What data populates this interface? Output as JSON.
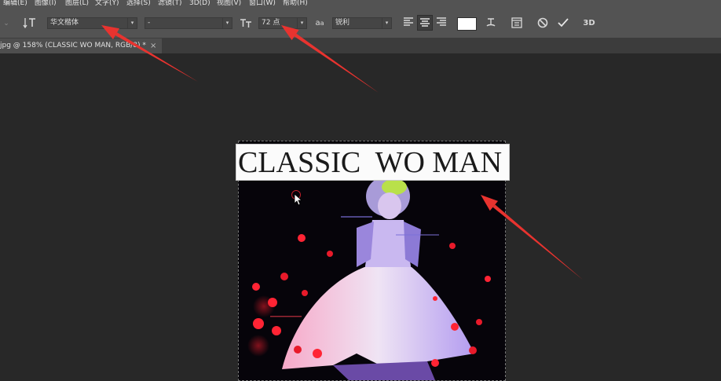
{
  "menu": [
    "编辑(E)",
    "图像(I)",
    "图层(L)",
    "文字(Y)",
    "选择(S)",
    "滤镜(T)",
    "3D(D)",
    "视图(V)",
    "窗口(W)",
    "帮助(H)"
  ],
  "options": {
    "font_family": "华文楷体",
    "font_style": "-",
    "font_size": "72 点",
    "aa_label": "a",
    "anti_alias": "锐利",
    "text_color": "#ffffff"
  },
  "tab": {
    "title": "jpg @ 158% (CLASSIC  WO MAN, RGB/8) *",
    "close": "×"
  },
  "canvas": {
    "headline": "CLASSIC  WO MAN"
  },
  "colors": {
    "annotation_arrow": "#e8332f"
  }
}
